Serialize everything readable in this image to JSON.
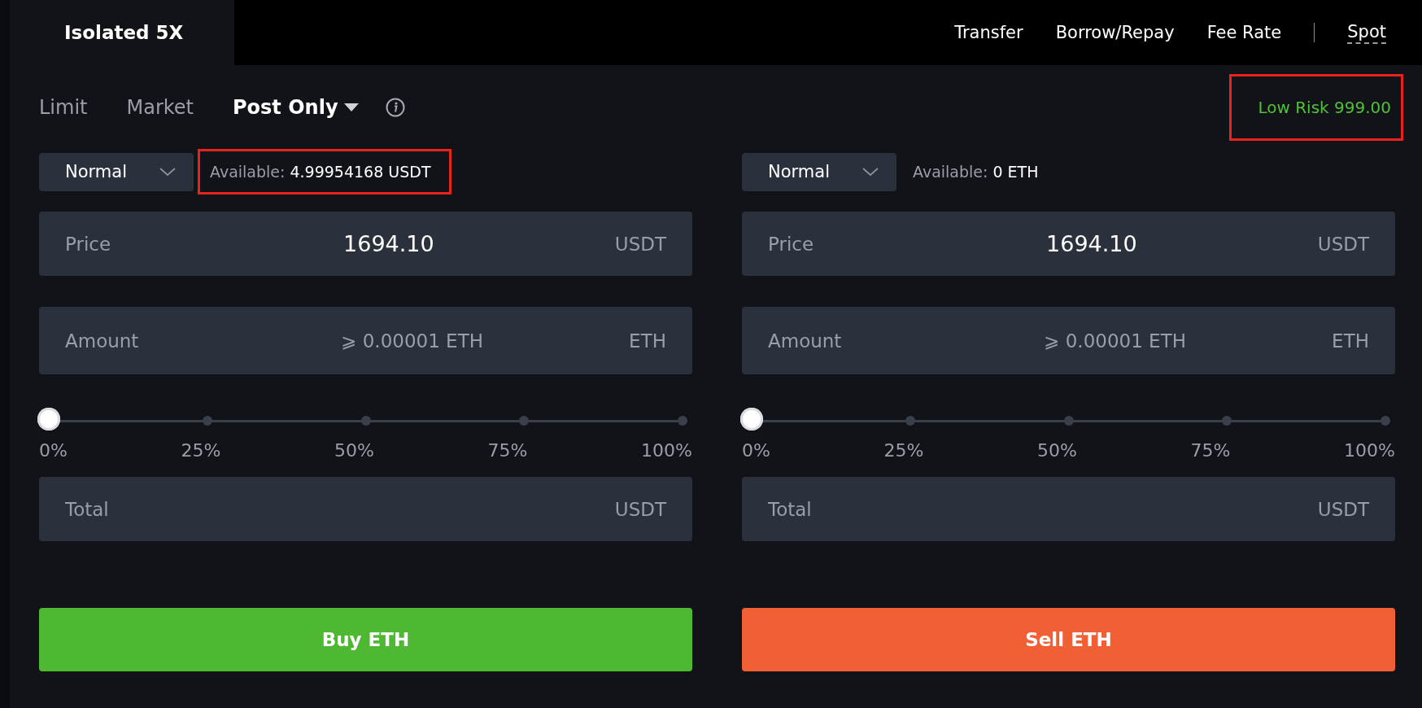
{
  "header": {
    "account_tab": {
      "label": "Isolated 5X",
      "selected": true
    },
    "links": [
      {
        "label": "Transfer"
      },
      {
        "label": "Borrow/Repay"
      },
      {
        "label": "Fee Rate"
      }
    ],
    "mode_link": {
      "label": "Spot"
    }
  },
  "order_types": [
    {
      "label": "Limit",
      "selected": false,
      "kind": "plain"
    },
    {
      "label": "Market",
      "selected": false,
      "kind": "plain"
    },
    {
      "label": "Post Only",
      "selected": true,
      "kind": "dropdown"
    }
  ],
  "risk": {
    "label": "Low Risk 999.00",
    "highlighted": true
  },
  "panels": [
    {
      "mode": "Normal",
      "available": {
        "label": "Available:",
        "value": "4.99954168 USDT",
        "highlighted": true
      },
      "price": {
        "label": "Price",
        "value": "1694.10",
        "unit": "USDT"
      },
      "amount": {
        "label": "Amount",
        "placeholder": "⩾ 0.00001 ETH",
        "unit": "ETH"
      },
      "slider": {
        "level": 0,
        "marks": [
          "0%",
          "25%",
          "50%",
          "75%",
          "100%"
        ]
      },
      "total": {
        "label": "Total",
        "unit": "USDT"
      },
      "button": {
        "label": "Buy ETH",
        "kind": "buy"
      }
    },
    {
      "mode": "Normal",
      "available": {
        "label": "Available:",
        "value": "0 ETH",
        "highlighted": false
      },
      "price": {
        "label": "Price",
        "value": "1694.10",
        "unit": "USDT"
      },
      "amount": {
        "label": "Amount",
        "placeholder": "⩾ 0.00001 ETH",
        "unit": "ETH"
      },
      "slider": {
        "level": 0,
        "marks": [
          "0%",
          "25%",
          "50%",
          "75%",
          "100%"
        ]
      },
      "total": {
        "label": "Total",
        "unit": "USDT"
      },
      "button": {
        "label": "Sell ETH",
        "kind": "sell"
      }
    }
  ]
}
